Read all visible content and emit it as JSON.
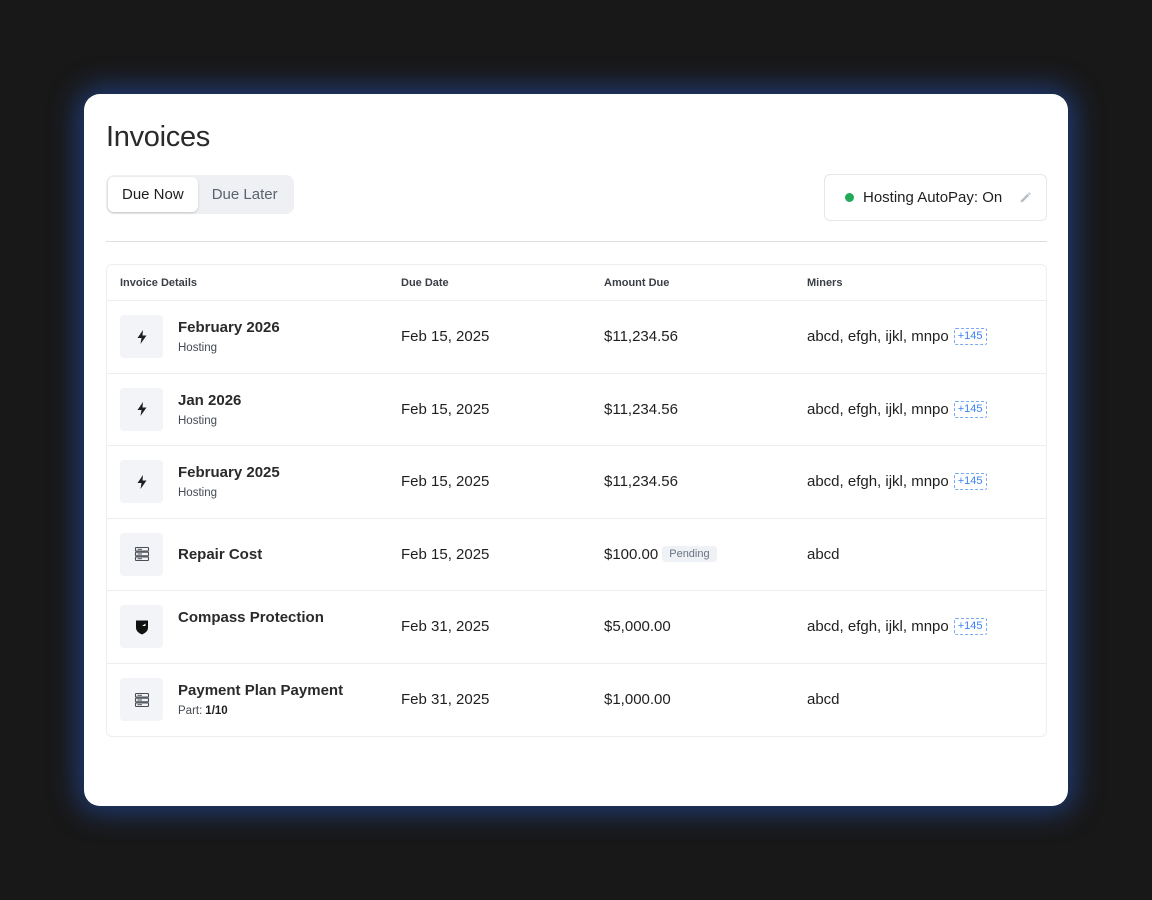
{
  "header": {
    "title": "Invoices"
  },
  "tabs": [
    {
      "label": "Due Now",
      "active": true
    },
    {
      "label": "Due Later",
      "active": false
    }
  ],
  "autopay": {
    "label": "Hosting AutoPay: On",
    "status_color": "#22a95a",
    "icon": "pencil-icon"
  },
  "table": {
    "columns": [
      "Invoice Details",
      "Due Date",
      "Amount Due",
      "Miners"
    ],
    "rows": [
      {
        "icon": "lightning-icon",
        "title": "February 2026",
        "subtitle": "Hosting",
        "due_date": "Feb 15, 2025",
        "amount": "$11,234.56",
        "miners": "abcd, efgh, ijkl, mnpo",
        "more": "+145"
      },
      {
        "icon": "lightning-icon",
        "title": "Jan 2026",
        "subtitle": "Hosting",
        "due_date": "Feb 15, 2025",
        "amount": "$11,234.56",
        "miners": "abcd, efgh, ijkl, mnpo",
        "more": "+145"
      },
      {
        "icon": "lightning-icon",
        "title": "February 2025",
        "subtitle": "Hosting",
        "due_date": "Feb 15, 2025",
        "amount": "$11,234.56",
        "miners": "abcd, efgh, ijkl, mnpo",
        "more": "+145"
      },
      {
        "icon": "server-icon",
        "title": "Repair Cost",
        "due_date": "Feb 15, 2025",
        "amount": "$100.00",
        "badge": "Pending",
        "miners": "abcd"
      },
      {
        "icon": "shield-icon",
        "title": "Compass Protection",
        "due_date": "Feb 31, 2025",
        "amount": "$5,000.00",
        "miners": "abcd, efgh, ijkl, mnpo",
        "more": "+145"
      },
      {
        "icon": "server-icon",
        "title": "Payment Plan Payment",
        "subtitle": "Part:",
        "subtitle_value": "1/10",
        "due_date": "Feb 31, 2025",
        "amount": "$1,000.00",
        "miners": "abcd"
      }
    ]
  }
}
